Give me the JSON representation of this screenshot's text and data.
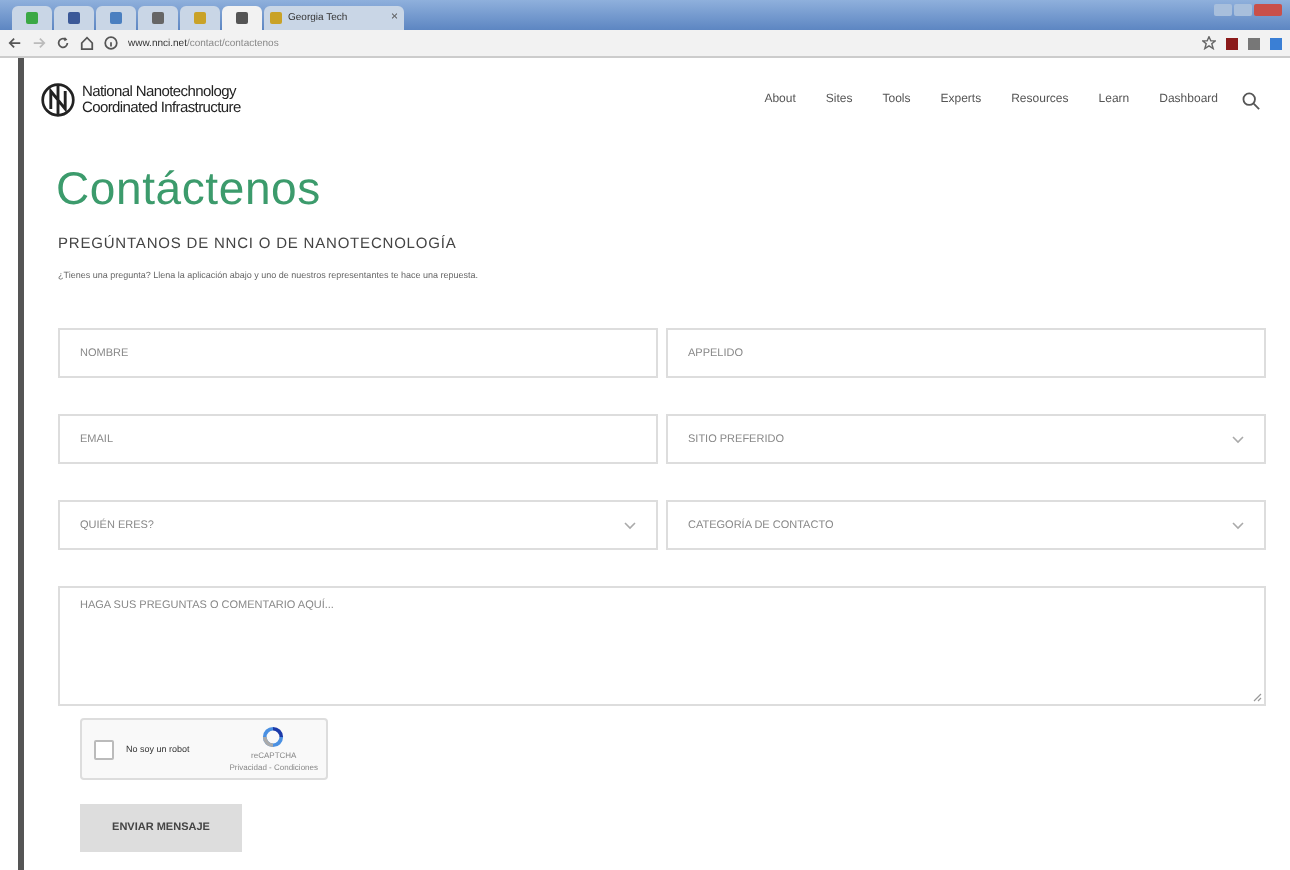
{
  "browser": {
    "tabs": [
      {
        "color": "#3aa845",
        "selected": false
      },
      {
        "color": "#3b5998",
        "selected": false
      },
      {
        "color": "#4a7fc0",
        "selected": false
      },
      {
        "color": "#666666",
        "selected": false
      },
      {
        "color": "#c9a227",
        "selected": false
      },
      {
        "color": "#555555",
        "selected": true
      },
      {
        "color": "#c9a227",
        "selected": false,
        "label": "Georgia Tech",
        "close": "×"
      }
    ],
    "address_host": "www.nnci.net",
    "address_path": "/contact/contactenos"
  },
  "site": {
    "logo_lines": [
      "National Nanotechnology",
      "Coordinated Infrastructure"
    ],
    "nav": [
      "About",
      "Sites",
      "Tools",
      "Experts",
      "Resources",
      "Learn",
      "Dashboard"
    ]
  },
  "page": {
    "title": "Contáctenos",
    "subtitle": "PREGÚNTANOS DE NNCI O DE NANOTECNOLOGÍA",
    "description": "¿Tienes una pregunta? Llena la aplicación abajo y uno de nuestros representantes te hace una repuesta."
  },
  "form": {
    "rows": [
      [
        {
          "kind": "input",
          "placeholder": "NOMBRE"
        },
        {
          "kind": "input",
          "placeholder": "APPELIDO"
        }
      ],
      [
        {
          "kind": "input",
          "placeholder": "EMAIL"
        },
        {
          "kind": "select",
          "placeholder": "SITIO PREFERIDO"
        }
      ],
      [
        {
          "kind": "select",
          "placeholder": "QUIÉN ERES?"
        },
        {
          "kind": "select",
          "placeholder": "CATEGORÍA DE CONTACTO"
        }
      ]
    ],
    "message": {
      "placeholder": "HAGA SUS PREGUNTAS O COMENTARIO AQUÍ..."
    },
    "captcha": {
      "label": "No soy un robot",
      "checked": false,
      "brand": "reCAPTCHA",
      "links": "Privacidad - Condiciones"
    },
    "submit": "ENVIAR MENSAJE"
  }
}
